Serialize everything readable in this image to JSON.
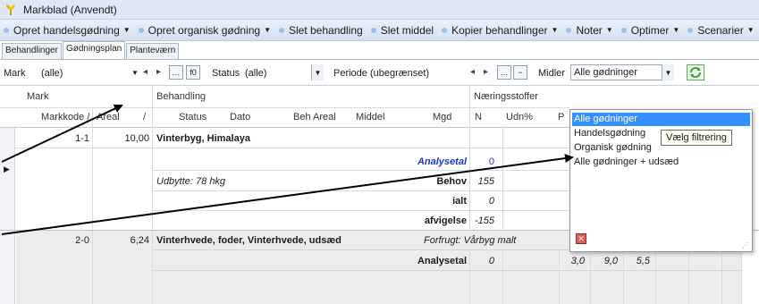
{
  "window": {
    "title": "Markblad (Anvendt)"
  },
  "toolbar": {
    "items": [
      {
        "label": "Opret handelsgødning",
        "caret": "▼"
      },
      {
        "label": "Opret organisk gødning",
        "caret": "▼"
      },
      {
        "label": "Slet behandling",
        "caret": ""
      },
      {
        "label": "Slet middel",
        "caret": ""
      },
      {
        "label": "Kopier behandlinger",
        "caret": "▼"
      },
      {
        "label": "Noter",
        "caret": "▼"
      },
      {
        "label": "Optimer",
        "caret": "▼"
      },
      {
        "label": "Scenarier",
        "caret": "▼"
      }
    ]
  },
  "tabs": [
    "Behandlinger",
    "Gødningsplan",
    "Planteværn"
  ],
  "filters": {
    "mark_label": "Mark",
    "mark_value": "(alle)",
    "status_label": "Status",
    "status_value": "(alle)",
    "periode_label": "Periode",
    "periode_value": "(ubegrænset)",
    "midler_label": "Midler",
    "midler_value": "Alle gødninger",
    "ellipsis": "…",
    "f0": "f0",
    "minus": "−"
  },
  "grid": {
    "group_headers": {
      "mark": "Mark",
      "behandling": "Behandling",
      "naeringsstoffer": "Næringsstoffer"
    },
    "columns": {
      "markkode": "Markkode /",
      "areal": "Areal",
      "sort": "/",
      "status": "Status",
      "dato": "Dato",
      "beh_areal": "Beh Areal",
      "middel": "Middel",
      "mgd": "Mgd",
      "n": "N",
      "udn": "Udn%",
      "p": "P"
    },
    "row1": {
      "markkode": "1-1",
      "areal": "10,00",
      "crop": "Vinterbyg, Himalaya",
      "analysetal": "Analysetal",
      "analysetal_n": "0",
      "udbytte": "Udbytte: 78 hkg",
      "behov": "Behov",
      "behov_n": "155",
      "ialt": "ialt",
      "ialt_n": "0",
      "afvigelse": "afvigelse",
      "afvigelse_n": "-155"
    },
    "row2": {
      "markkode": "2-0",
      "areal": "6,24",
      "crop": "Vinterhvede, foder, Vinterhvede, udsæd",
      "forfrugt": "Forfrugt: Vårbyg malt",
      "analysetal": "Analysetal",
      "analysetal_n": "0",
      "v1": "3,0",
      "v2": "9,0",
      "v3": "5,5"
    }
  },
  "dropdown": {
    "options": [
      "Alle gødninger",
      "Handelsgødning",
      "Organisk gødning",
      "Alle gødninger + udsæd"
    ],
    "selected_index": 0,
    "tooltip": "Vælg filtrering"
  },
  "colors": {
    "selection": "#3390ff",
    "toolbar_bg": "#d4e1f1",
    "analysetal_blue": "#1a36c8",
    "tooltip_bg": "#fffff0"
  }
}
